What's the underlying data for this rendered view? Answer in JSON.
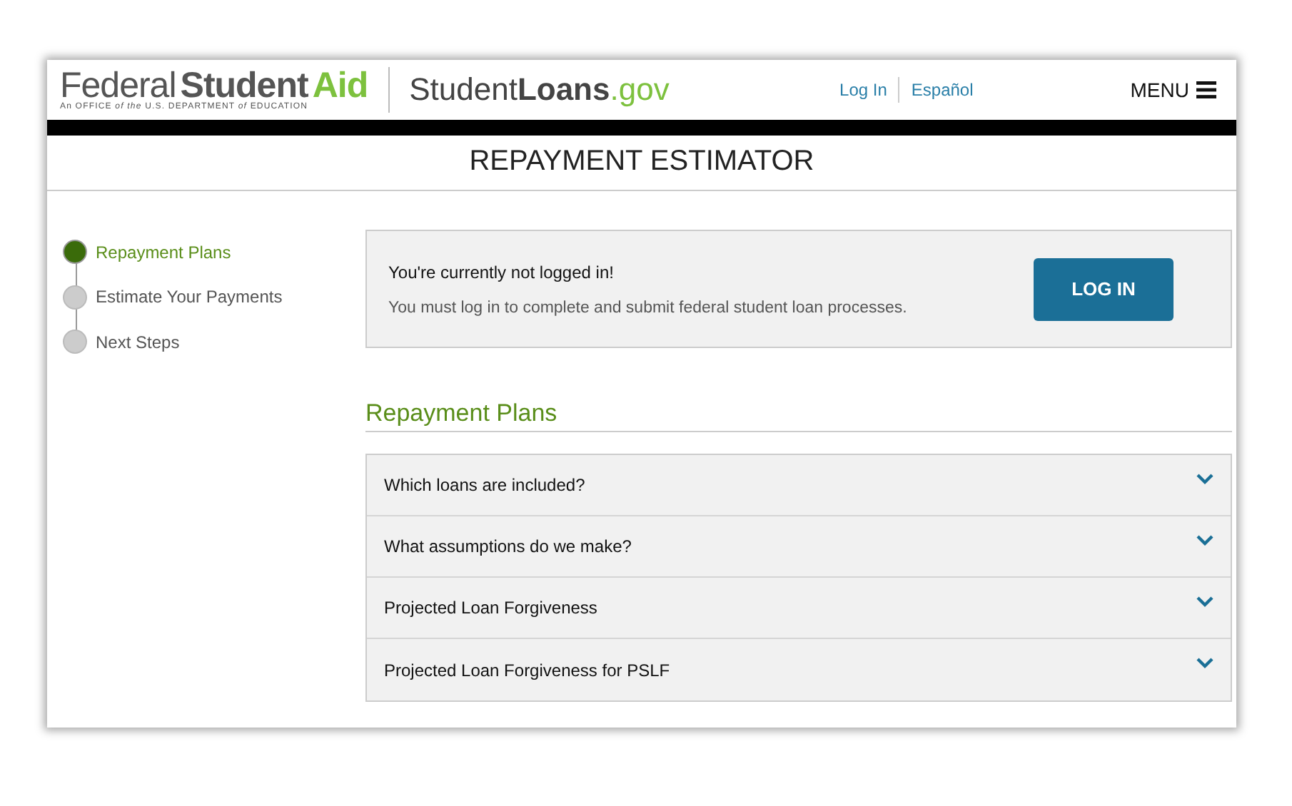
{
  "header": {
    "logo_parts": [
      {
        "text": "Federal",
        "kind": "light"
      },
      {
        "text": "Student",
        "kind": "bold"
      },
      {
        "text": "Aid",
        "kind": "accent"
      }
    ],
    "logo_subtitle": "An OFFICE *of the* U.S. DEPARTMENT *of* EDUCATION",
    "site_parts": [
      {
        "text": "Student",
        "kind": "light"
      },
      {
        "text": "Loans",
        "kind": "bold"
      },
      {
        "text": ".gov",
        "kind": "accent"
      }
    ],
    "links": [
      "Log In",
      "Español"
    ],
    "menu": "MENU"
  },
  "page_title": "REPAYMENT ESTIMATOR",
  "steps": [
    {
      "label": "Repayment Plans",
      "selected": true
    },
    {
      "label": "Estimate Your Payments",
      "selected": false
    },
    {
      "label": "Next Steps",
      "selected": false
    }
  ],
  "notice": {
    "title": "You're currently not logged in!",
    "text": "You must log in to complete and submit federal student loan processes.",
    "button": "LOG IN"
  },
  "section_title": "Repayment Plans",
  "accordion": [
    {
      "label": "Which loans are included?",
      "expanded": false
    },
    {
      "label": "What assumptions do we make?",
      "expanded": false
    },
    {
      "label": "Projected Loan Forgiveness",
      "expanded": false
    },
    {
      "label": "Projected Loan Forgiveness for PSLF",
      "expanded": false
    }
  ]
}
